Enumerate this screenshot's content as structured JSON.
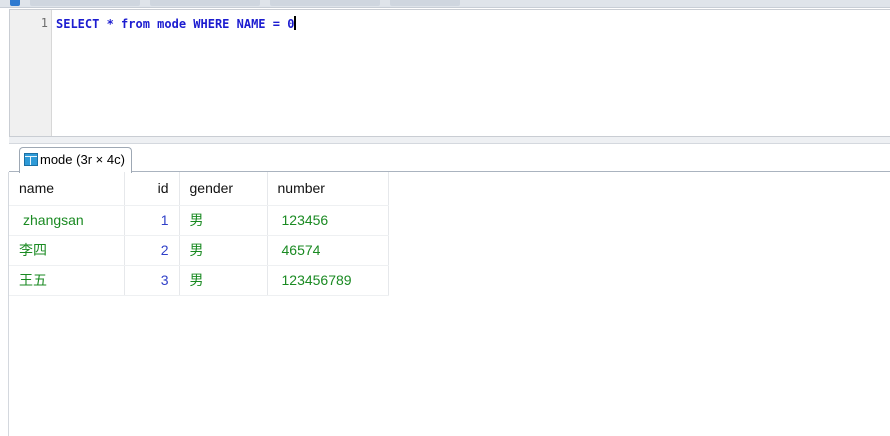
{
  "editor": {
    "line_number": "1",
    "query": "SELECT * from mode WHERE NAME = 0"
  },
  "result_tab": {
    "label": "mode (3r × 4c)",
    "icon": "table-icon"
  },
  "grid": {
    "headers": [
      "name",
      "id",
      "gender",
      "number"
    ],
    "rows": [
      [
        "zhangsan",
        "1",
        "男",
        "123456"
      ],
      [
        "李四",
        "2",
        "男",
        "46574"
      ],
      [
        "王五",
        "3",
        "男",
        "123456789"
      ]
    ]
  },
  "colors": {
    "keyword": "#1c1cd0",
    "text_value": "#1a8a22",
    "numeric_value": "#2f3fc8"
  }
}
